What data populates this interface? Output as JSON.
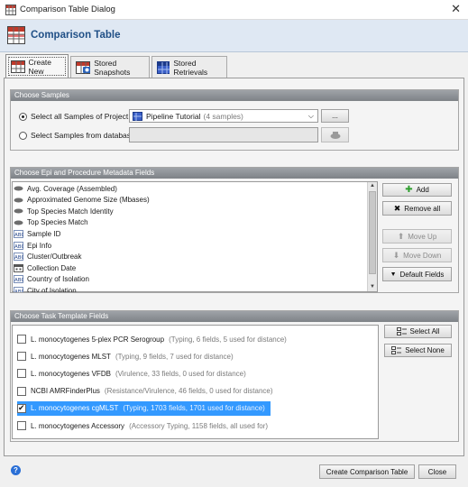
{
  "window": {
    "title": "Comparison Table Dialog",
    "close_glyph": "✕"
  },
  "header": {
    "title": "Comparison Table"
  },
  "tabs": [
    {
      "label": "Create New",
      "icon": "table-new-icon"
    },
    {
      "label": "Stored Snapshots",
      "icon": "snapshot-icon"
    },
    {
      "label": "Stored Retrievals",
      "icon": "retrieval-icon"
    }
  ],
  "samples": {
    "section_title": "Choose Samples",
    "option_project_label": "Select all Samples of Project:",
    "project_value": "Pipeline Tutorial",
    "project_count": "(4 samples)",
    "browse_label": "...",
    "option_database_label": "Select Samples from database:",
    "database_value": ""
  },
  "metadata": {
    "section_title": "Choose Epi and Procedure Metadata Fields",
    "fields": [
      {
        "label": "Avg. Coverage (Assembled)",
        "icon": "numeric-field-icon"
      },
      {
        "label": "Approximated Genome Size (Mbases)",
        "icon": "numeric-field-icon"
      },
      {
        "label": "Top Species Match Identity",
        "icon": "numeric-field-icon"
      },
      {
        "label": "Top Species Match",
        "icon": "numeric-field-icon"
      },
      {
        "label": "Sample ID",
        "icon": "text-field-icon"
      },
      {
        "label": "Epi Info",
        "icon": "text-field-icon"
      },
      {
        "label": "Cluster/Outbreak",
        "icon": "text-field-icon"
      },
      {
        "label": "Collection Date",
        "icon": "date-field-icon"
      },
      {
        "label": "Country of Isolation",
        "icon": "text-field-icon"
      },
      {
        "label": "City of Isolation",
        "icon": "text-field-icon"
      }
    ],
    "buttons": {
      "add": "Add",
      "remove_all": "Remove all",
      "move_up": "Move Up",
      "move_down": "Move Down",
      "default_fields": "Default Fields"
    }
  },
  "task": {
    "section_title": "Choose Task Template Fields",
    "templates": [
      {
        "name": "L. monocytogenes 5-plex PCR Serogroup",
        "detail": "(Typing, 6 fields, 5 used for distance)",
        "checked": false,
        "selected": false
      },
      {
        "name": "L. monocytogenes MLST",
        "detail": "(Typing, 9 fields, 7 used for distance)",
        "checked": false,
        "selected": false
      },
      {
        "name": "L. monocytogenes VFDB",
        "detail": "(Virulence, 33 fields, 0 used for distance)",
        "checked": false,
        "selected": false
      },
      {
        "name": "NCBI AMRFinderPlus",
        "detail": "(Resistance/Virulence, 46 fields, 0 used for distance)",
        "checked": false,
        "selected": false
      },
      {
        "name": "L. monocytogenes cgMLST",
        "detail": "(Typing, 1703 fields, 1701 used for distance)",
        "checked": true,
        "selected": true
      },
      {
        "name": "L. monocytogenes Accessory",
        "detail": "(Accessory Typing, 1158 fields, all used for)",
        "checked": false,
        "selected": false
      }
    ],
    "select_all": "Select All",
    "select_none": "Select None"
  },
  "footer": {
    "help_glyph": "?",
    "create_label": "Create Comparison Table",
    "close_label": "Close"
  },
  "colors": {
    "accent": "#1f4f86",
    "selection": "#3399ff",
    "section_header": "#8a8e93"
  }
}
